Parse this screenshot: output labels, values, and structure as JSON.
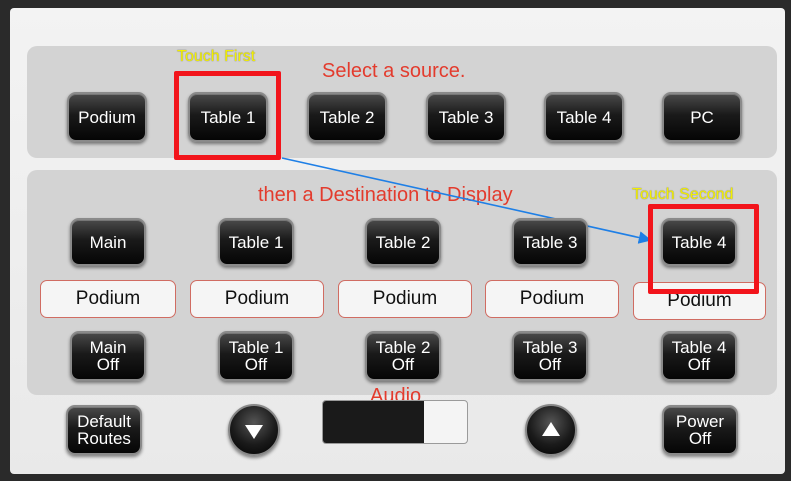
{
  "colors": {
    "annotation_red": "#f2141b",
    "label_red": "#e33b2d",
    "hint_yellow": "#f3f000"
  },
  "annotations": {
    "touch_first": "Touch First",
    "touch_second": "Touch Second"
  },
  "sources": {
    "heading": "Select a source.",
    "buttons": [
      "Podium",
      "Table 1",
      "Table 2",
      "Table 3",
      "Table 4",
      "PC"
    ],
    "highlighted": "Table 1"
  },
  "destinations": {
    "heading": "then a Destination to Display",
    "buttons": [
      "Main",
      "Table 1",
      "Table 2",
      "Table 3",
      "Table 4"
    ],
    "highlighted": "Table 4",
    "routed_sources": [
      "Podium",
      "Podium",
      "Podium",
      "Podium",
      "Podium"
    ],
    "off_buttons": [
      "Main\nOff",
      "Table 1\nOff",
      "Table 2\nOff",
      "Table 3\nOff",
      "Table 4\nOff"
    ]
  },
  "footer": {
    "default_routes": "Default\nRoutes",
    "audio_label": "Audio",
    "audio_level": 0.7,
    "power_off": "Power\nOff",
    "volume_down_icon": "triangle-down-icon",
    "volume_up_icon": "triangle-up-icon"
  }
}
